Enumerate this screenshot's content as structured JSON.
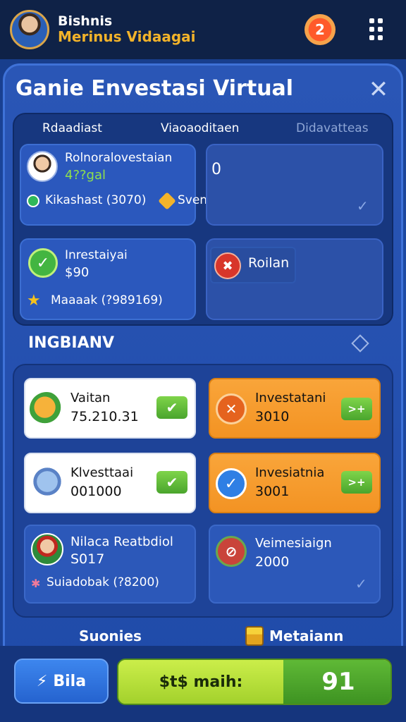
{
  "header": {
    "username": "Bishnis",
    "subname": "Merinus Vidaagai",
    "notification_count": "2"
  },
  "dialog": {
    "title": "Ganie Envestasi Virtual",
    "close_glyph": "✕"
  },
  "tabs": [
    {
      "label": "Rdaadiast"
    },
    {
      "label": "Viaoaoditaen"
    },
    {
      "label": "Didavatteas"
    }
  ],
  "cards": {
    "balance": {
      "title": "Rolnoralovestaian",
      "value": "4??gal",
      "badge1": "Kikashast (3070)",
      "badge2": "Svenicalsai"
    },
    "counter": {
      "value": "0"
    },
    "invest": {
      "title": "Inrestaiyai",
      "value": "$90",
      "star_label": "Maaaak (?989169)"
    },
    "roll": {
      "label": "Roilan"
    }
  },
  "inventory": {
    "heading": "INGBIANV",
    "items": [
      {
        "title": "Vaitan",
        "value": "75.210.31",
        "style": "white",
        "action_glyph": "✔"
      },
      {
        "title": "Investatani",
        "value": "3010",
        "style": "orange",
        "action_glyph": ">+"
      },
      {
        "title": "Klvesttaai",
        "value": "001000",
        "style": "white",
        "action_glyph": "✔"
      },
      {
        "title": "Invesiatnia",
        "value": "3001",
        "style": "orange",
        "action_glyph": ">+"
      },
      {
        "title": "Nilaca Reatbdiol",
        "value": "S017",
        "extra": "Suiadobak (?8200)",
        "style": "blue"
      },
      {
        "title": "Veimesiaign",
        "value": "2000",
        "style": "blue"
      }
    ]
  },
  "footer": {
    "left_label": "Suonies",
    "right_label": "Metaiann",
    "btn_bila": "Bila",
    "btn_main_left": "$t$ maih:",
    "btn_main_right": "91"
  },
  "colors": {
    "accent_orange": "#f39323",
    "accent_green": "#4aa52d",
    "panel_blue": "#2a56b6",
    "gold": "#f2b32a"
  }
}
